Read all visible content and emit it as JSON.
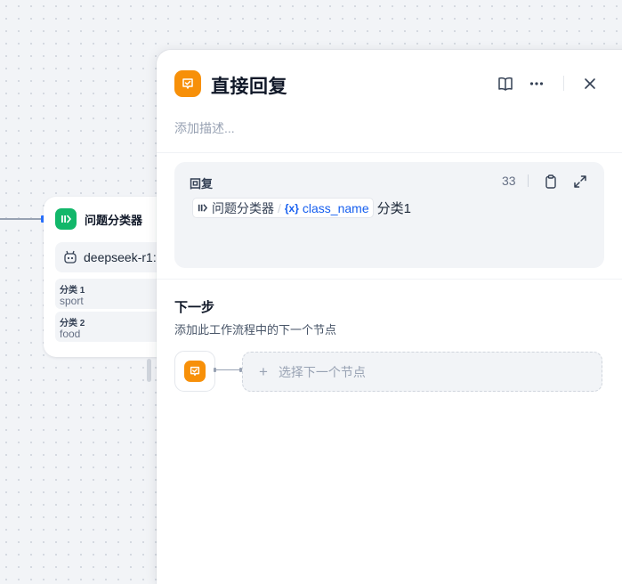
{
  "canvas": {
    "node": {
      "title": "问题分类器",
      "model": "deepseek-r1:",
      "classes": [
        {
          "label": "分类 1",
          "value": "sport"
        },
        {
          "label": "分类 2",
          "value": "food"
        }
      ]
    }
  },
  "panel": {
    "title": "直接回复",
    "description_placeholder": "添加描述...",
    "reply": {
      "label": "回复",
      "count": "33",
      "var_node": "问题分类器",
      "var_separator": "/",
      "var_icon_text": "{x}",
      "var_name": "class_name",
      "trailing_text": "分类1"
    },
    "next": {
      "title": "下一步",
      "description": "添加此工作流程中的下一个节点",
      "plus": "+",
      "select_label": "选择下一个节点"
    }
  },
  "colors": {
    "reply_icon": "#f79009",
    "classifier_icon": "#12b76a",
    "variable_accent": "#155eef"
  },
  "icons": {
    "reply": "reply-icon",
    "classifier": "classifier-icon",
    "book": "book-icon",
    "more": "more-icon",
    "close": "close-icon",
    "clipboard": "clipboard-icon",
    "expand": "expand-icon",
    "robot": "robot-icon"
  }
}
